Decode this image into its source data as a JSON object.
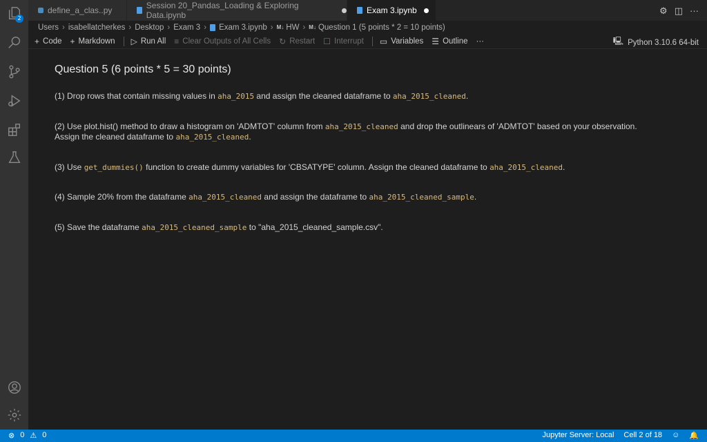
{
  "activity_bar": {
    "explorer_badge": "2"
  },
  "tabs": [
    {
      "label": "define_a_clas..py",
      "modified": false,
      "active": false
    },
    {
      "label": "Session 20_Pandas_Loading & Exploring Data.ipynb",
      "modified": true,
      "active": false
    },
    {
      "label": "Exam 3.ipynb",
      "modified": true,
      "active": true
    }
  ],
  "tab_actions": {
    "settings": "⚙",
    "split": "◫",
    "more": "···"
  },
  "breadcrumb": {
    "items": [
      "Users",
      "isabellatcherkes",
      "Desktop",
      "Exam 3",
      "Exam 3.ipynb",
      "HW",
      "Question 1 (5 points * 2 = 10 points)"
    ],
    "md_prefix": "M↓"
  },
  "toolbar": {
    "code_label": "Code",
    "markdown_label": "Markdown",
    "run_all_label": "Run All",
    "clear_outputs_label": "Clear Outputs of All Cells",
    "restart_label": "Restart",
    "interrupt_label": "Interrupt",
    "variables_label": "Variables",
    "outline_label": "Outline",
    "more_label": "···",
    "kernel_label": "Python 3.10.6 64-bit"
  },
  "content": {
    "title": "Question 5 (6 points * 5 = 30 points)",
    "q1": {
      "a": "(1) Drop rows that contain missing values in ",
      "c1": "aha_2015",
      "b": " and assign the cleaned dataframe to ",
      "c2": "aha_2015_cleaned",
      "end": "."
    },
    "q2": {
      "a": "(2) Use plot.hist() method to draw a histogram on 'ADMTOT' column from ",
      "c1": "aha_2015_cleaned",
      "b": " and drop the outlinears of 'ADMTOT' based on your observation.",
      "line2a": "Assign the cleaned dataframe to ",
      "c2": "aha_2015_cleaned",
      "end": "."
    },
    "q3": {
      "a": "(3) Use ",
      "c1": "get_dummies()",
      "b": " function to create dummy variables for 'CBSATYPE' column. Assign the cleaned dataframe to ",
      "c2": "aha_2015_cleaned",
      "end": "."
    },
    "q4": {
      "a": "(4) Sample 20% from the dataframe ",
      "c1": "aha_2015_cleaned",
      "b": " and assign the dataframe to ",
      "c2": "aha_2015_cleaned_sample",
      "end": "."
    },
    "q5": {
      "a": "(5) Save the dataframe ",
      "c1": "aha_2015_cleaned_sample",
      "b": " to \"aha_2015_cleaned_sample.csv\"."
    }
  },
  "statusbar": {
    "errors": "0",
    "warnings": "0",
    "jupyter_server": "Jupyter Server: Local",
    "cell_position": "Cell 2 of 18"
  },
  "colors": {
    "accent": "#007acc",
    "code_text": "#d7ba7d",
    "background": "#1e1e1e",
    "activity_bar": "#333333"
  }
}
